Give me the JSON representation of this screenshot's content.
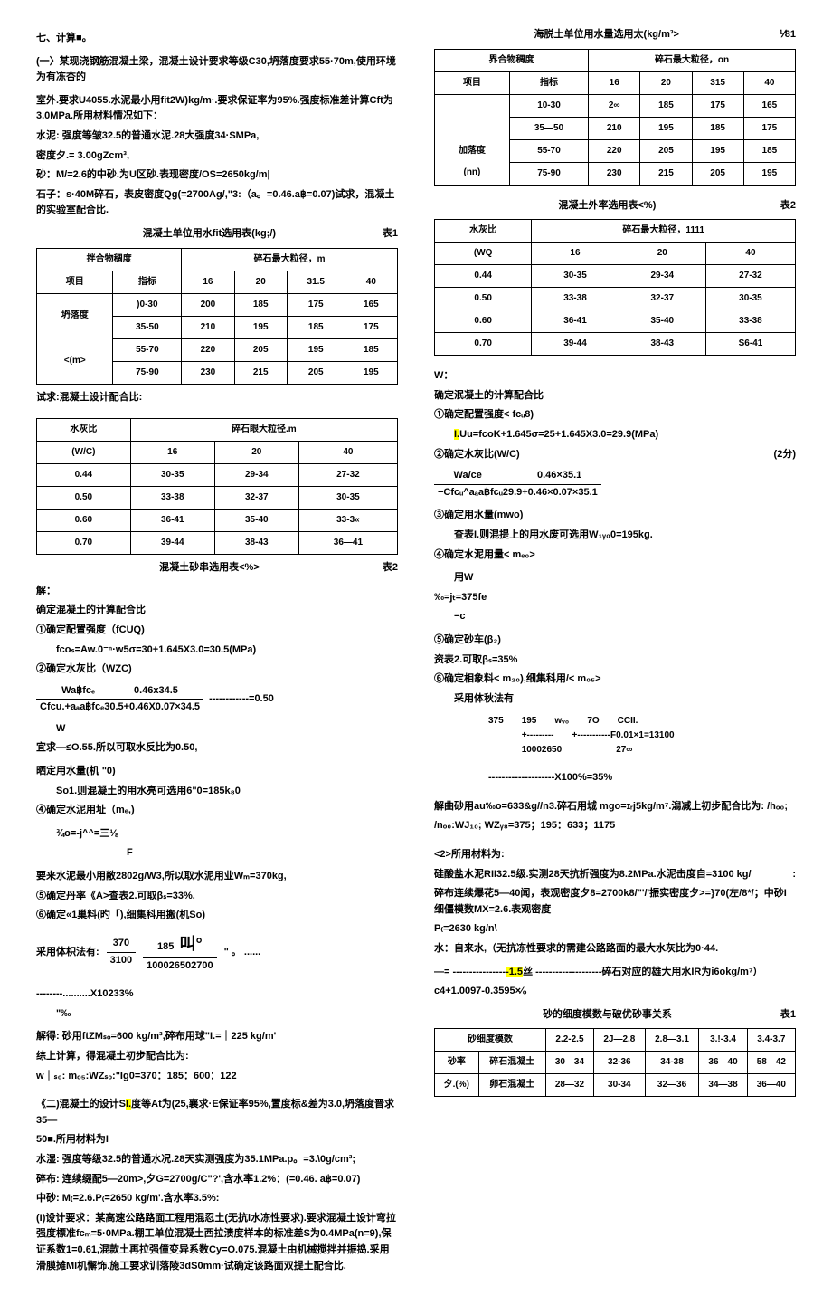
{
  "left": {
    "h1": "七、计算■。",
    "p1": "(一〉某现浇钢筋混凝土梁，混凝土设计要求等级C30,坍落度要求55·70m,使用环境为有冻杏的",
    "p2": "室外.要求U4055.水泥最小用fit2W)kg/m·.要求保证率为95%.强度标准差计算Cft为3.0MPa.所用材料情况如下：",
    "p3": "水泥: 强度等皱32.5的普通水泥.28大强度34·SMPa,",
    "p4": "密度夕.= 3.00gZcm³,",
    "p5": "砂：M/=2.6的中砂.为U区砂.表现密度/OS=2650kg/m|",
    "p6": "石子：s·40M碎石，表皮密度Qg(=2700Ag/,\"3:（a。=0.46.a฿=0.07)试求，混凝土的实验室配合比.",
    "t1_caption_left": "混凝土单位用水fit选用表(kg;/)",
    "t1_caption_right": "表1",
    "t1": {
      "h1a": "拌合物稠度",
      "h1b": "碎石最大粒径，m",
      "h2a": "项目",
      "h2b": "指标",
      "h2c": "16",
      "h2d": "20",
      "h2e": "31.5",
      "h2f": "40",
      "r1a": "坍落度",
      "r1b": ")0-30",
      "r1c": "200",
      "r1d": "185",
      "r1e": "175",
      "r1f": "165",
      "r2b": "35-50",
      "r2c": "210",
      "r2d": "195",
      "r2e": "185",
      "r2f": "175",
      "r3a": "<(m>",
      "r3b": "55-70",
      "r3c": "220",
      "r3d": "205",
      "r3e": "195",
      "r3f": "185",
      "r4b": "75-90",
      "r4c": "230",
      "r4d": "215",
      "r4e": "205",
      "r4f": "195"
    },
    "p7": "试求:混凝土设计配合比:",
    "t2": {
      "h1a": "水灰比",
      "h1b": "碎石眼大粒径.m",
      "h2a": "(W/C)",
      "h2b": "16",
      "h2c": "20",
      "h2d": "40",
      "r1a": "0.44",
      "r1b": "30-35",
      "r1c": "29-34",
      "r1d": "27-32",
      "r2a": "0.50",
      "r2b": "33-38",
      "r2c": "32-37",
      "r2d": "30-35",
      "r3a": "0.60",
      "r3b": "36-41",
      "r3c": "35-40",
      "r3d": "33-3«",
      "r4a": "0.70",
      "r4b": "39-44",
      "r4c": "38-43",
      "r4d": "36—41"
    },
    "t2_caption": "混凝土砂串选用表<%>",
    "t2_caption_r": "表2",
    "sol_h": "解：",
    "s1": "确定混凝土的计算配合比",
    "s2": "①确定配置强度（fCUQ)",
    "s3": "fcoₛ=Aw.0⁻ⁿ·w5σ=30+1.645X3.0=30.5(MPa)",
    "s4": "②确定水灰比（WZC)",
    "s5_top": "Wa฿fcₑ",
    "s5_right": "0.46x34.5",
    "s5_bot": "Cfcu.+aₐa฿fcₑ30.5+0.46X0.07×34.5",
    "s5_eq": "------------=0.50",
    "s6": "W",
    "s7": "宜求—≤O.55.所以可取水反比为0.50,",
    "s8": "晒定用水量(机 \"0)",
    "s9": "So1.则混凝土的用水亮可选用6\"0=185k₈0",
    "s10": "④确定水泥用址（mₑ,)",
    "s11": "¾o=-j^^=三⅛",
    "s12": "F",
    "s13": "要来水泥最小用敝2802g/W3,所以取水泥用业Wₘ=370kg,",
    "s14": "⑤确定丹率《A>查表2.可取βₛ=33%.",
    "s15": "⑥确定«1巢料(旳「),细集科用搬(机So)",
    "s16_pre": "采用体枳法有:",
    "s16_a": "370",
    "s16_b": "185",
    "s16_c": "叫°",
    "s16_d": "3100",
    "s16_e": "100026502700",
    "s16_f": "\" 。 ......",
    "s17": "--------..........X10233%",
    "s17b": "\"‰",
    "s18": "解得: 砂用ftZMₛₒ=600 kg/m³,碎布用球\"I.=｜225 kg/m'",
    "s19": "综上计算，得混凝土初步配合比为:",
    "s20": "w｜ₛ₀:  mₒ₅:WZₛₒ:\"Ig0=370：185：600：122",
    "q2a": "《二)混凝土的设计S",
    "q2b": "I.",
    "q2c": "度等At为(25,襄求·E保证率95%,置度标&差为3.0,坍落度晋求35—",
    "q2d": "50■.所用材料为I",
    "q2e": "水湿: 强度等级32.5的普通水况.28天实测强度为35.1MPa.ρ。=3.\\0g/cm³;",
    "q2f": "碎布: 连续缀配5—20m>,夕G=2700g/C\"?',含水率1.2%：(=0.46. a฿=0.07)",
    "q2g": "中砂: M₍=2.6.P₍=2650 kg/m'.含水率3.5%:",
    "q2h": "(I)设计要求：某高速公路路面工程用混忍土(无抗l水冻性要求).要求混凝土设计弯拉强度標准fcₘ=5·0MPa.棚工单位混凝土西拉渍度样本的标准差S为0.4MPa(n=9),保证系数1=0.61,混款土再拉强僮变异系数Cy=O.075.混凝土由机械搅拌并振捣.采用滑膜摊Ml机懈饰.施工要求训落陵3dS0mm·试确定该路面双提土配合比."
  },
  "right": {
    "rt_caption": "海脱土单位用水量选用太(kg/m³>",
    "rt_caption_r": "⅟81",
    "t1": {
      "h1a": "界合物稠度",
      "h1b": "碎石最大粒径，on",
      "h2a": "项目",
      "h2b": "指标",
      "h2c": "16",
      "h2d": "20",
      "h2e": "315",
      "h2f": "40",
      "r1b": "10-30",
      "r1c": "2∞",
      "r1d": "185",
      "r1e": "175",
      "r1f": "165",
      "r2a": "加落度",
      "r2b": "35—50",
      "r2c": "210",
      "r2d": "195",
      "r2e": "185",
      "r2f": "175",
      "r3a": "(nn)",
      "r3b": "55-70",
      "r3c": "220",
      "r3d": "205",
      "r3e": "195",
      "r3f": "185",
      "r4b": "75-90",
      "r4c": "230",
      "r4d": "215",
      "r4e": "205",
      "r4f": "195"
    },
    "t2_caption_l": "混凝土外率选用表<%)",
    "t2_caption_r": "表2",
    "t2": {
      "h1a": "水灰比",
      "h1b": "碎石最大粒径，1111",
      "h2a": "(WQ",
      "h2b": "16",
      "h2c": "20",
      "h2d": "40",
      "r1a": "0.44",
      "r1b": "30-35",
      "r1c": "29-34",
      "r1d": "27-32",
      "r2a": "0.50",
      "r2b": "33-38",
      "r2c": "32-37",
      "r2d": "30-35",
      "r3a": "0.60",
      "r3b": "36-41",
      "r3c": "35-40",
      "r3d": "33-38",
      "r4a": "0.70",
      "r4b": "39-44",
      "r4c": "38-43",
      "r4d": "S6-41"
    },
    "w": "W：",
    "r1": "确定泯凝土的计算配合比",
    "r2": "①确定配置强度< fcᵤ8)",
    "r3a": "I.",
    "r3b": "Uu=fcoK+1.645σ=25+1.645X3.0=29.9(MPa)",
    "r4": "②确定水灰比(W/C)",
    "r4r": "(2分)",
    "r5_top": "Wa/ce",
    "r5_right": "0.46×35.1",
    "r5_bot": "−Cfcᵤ^aₐa฿fcᵤ29.9+0.46×0.07×35.1",
    "r6": "③确定用水量(mwo)",
    "r7": "查表I.则混提上的用水废可选用W₁ᵧ₀0=195kg.",
    "r8": "④确定水泥用量< mₑ₀>",
    "r9": "用W",
    "r10": "‰=jₜ=375fe",
    "r11": "−c",
    "r12": "⑤确定砂车(β₂)",
    "r13": "资表2.可取βₛ=35%",
    "r14": "⑥确定相象料< m₂₀),细集科用/< m₀₅>",
    "r15": "采用体秋法有",
    "r16a": "375",
    "r16b": "195",
    "r16c": "wᵥ₀",
    "r16d": "7O",
    "r16e": "CCII.",
    "r16f": "+---------",
    "r16g": "+-----------F0.01×1=13100",
    "r16h": "10002650",
    "r16i": "27∞",
    "r17": "--------------------X100%=35%",
    "r18": "解曲砂用au‰o=633&g//n3.碎石用城 mgo=ɪᵣj5kg/m⁷.潟减上初步配合比为:  /hₒ₀;",
    "r19": "/nₒ₀:WJ₁₀;  WZᵧ₈=375；195：633；1175",
    "q2a": "<2>所用材料为:",
    "q2b": "硅酸盐水泥RII32.5级.实测28天抗折强度为8.2MPa.水泥击度自=3100 kg/",
    "q2b2": ":",
    "q2c": "碎布连续爆花5—40闻，表观密度夕8=2700k8/\"'/'振实密度夕>=}70(左/8*/；中砂I细僵模数MX=2.6.表观密度",
    "q2d": "P₍=2630 kg/n\\",
    "q2e": "水：自来水,（无抗冻性要求的需建公路路面的最大水灰比为0·44.",
    "q2f_a": "—= ----------------",
    "q2f_b": "-1.5",
    "q2f_c": "丝 --------------------碎石对应的雄大用水IR为i6okg/m⁷）",
    "q2g": "c4+1.0097-0.3595×⁄ₒ",
    "t3_cap_l": "砂的细度模数与破优砂事关系",
    "t3_cap_r": "表1",
    "t3": {
      "h1a": "砂细度模数",
      "h1b": "2.2-2.5",
      "h1c": "2J—2.8",
      "h1d": "2.8—3.1",
      "h1e": "3.!-3.4",
      "h1f": "3.4-3.7",
      "r1a": "砂率",
      "r1b": "碎石混凝土",
      "r1c": "30—34",
      "r1d": "32-36",
      "r1e": "34-38",
      "r1f": "36—40",
      "r1g": "58—42",
      "r2a": "夕.(%)",
      "r2b": "卵石混凝土",
      "r2c": "28—32",
      "r2d": "30-34",
      "r2e": "32—36",
      "r2f": "34—38",
      "r2g": "36—40"
    }
  }
}
